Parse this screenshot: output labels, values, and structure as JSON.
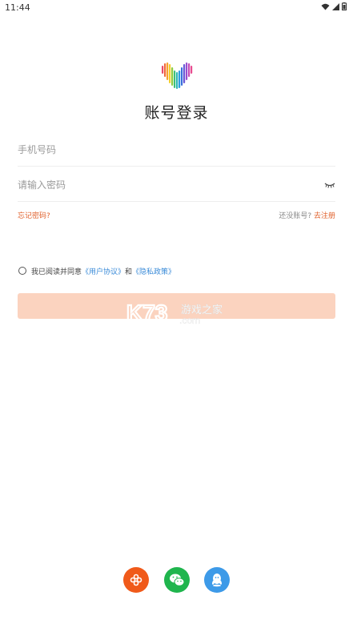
{
  "status_bar": {
    "time": "11:44",
    "icons": [
      "wifi-icon",
      "signal-icon",
      "battery-icon"
    ]
  },
  "header": {
    "title": "账号登录",
    "logo": "colorful-heart-logo"
  },
  "form": {
    "phone_placeholder": "手机号码",
    "password_placeholder": "请输入密码",
    "forgot_password": "忘记密码?",
    "no_account": "还没账号?",
    "register": "去注册",
    "agree_prefix": "我已阅读并同意",
    "user_agreement": "《用户协议》",
    "and": "和",
    "privacy_policy": "《隐私政策》",
    "login_button_label": ""
  },
  "watermark": {
    "brand": "K73",
    "cn_text": "游戏之家",
    "domain": ".com"
  },
  "social_login": [
    {
      "name": "unicom",
      "icon": "china-unicom-icon"
    },
    {
      "name": "wechat",
      "icon": "wechat-icon"
    },
    {
      "name": "qq",
      "icon": "qq-icon"
    }
  ],
  "colors": {
    "accent": "#e0602b",
    "link": "#3a8bd8",
    "login_button_disabled": "#fbd3bf",
    "unicom": "#f05a1a",
    "wechat": "#1fb54d",
    "qq": "#3d9ae8"
  }
}
